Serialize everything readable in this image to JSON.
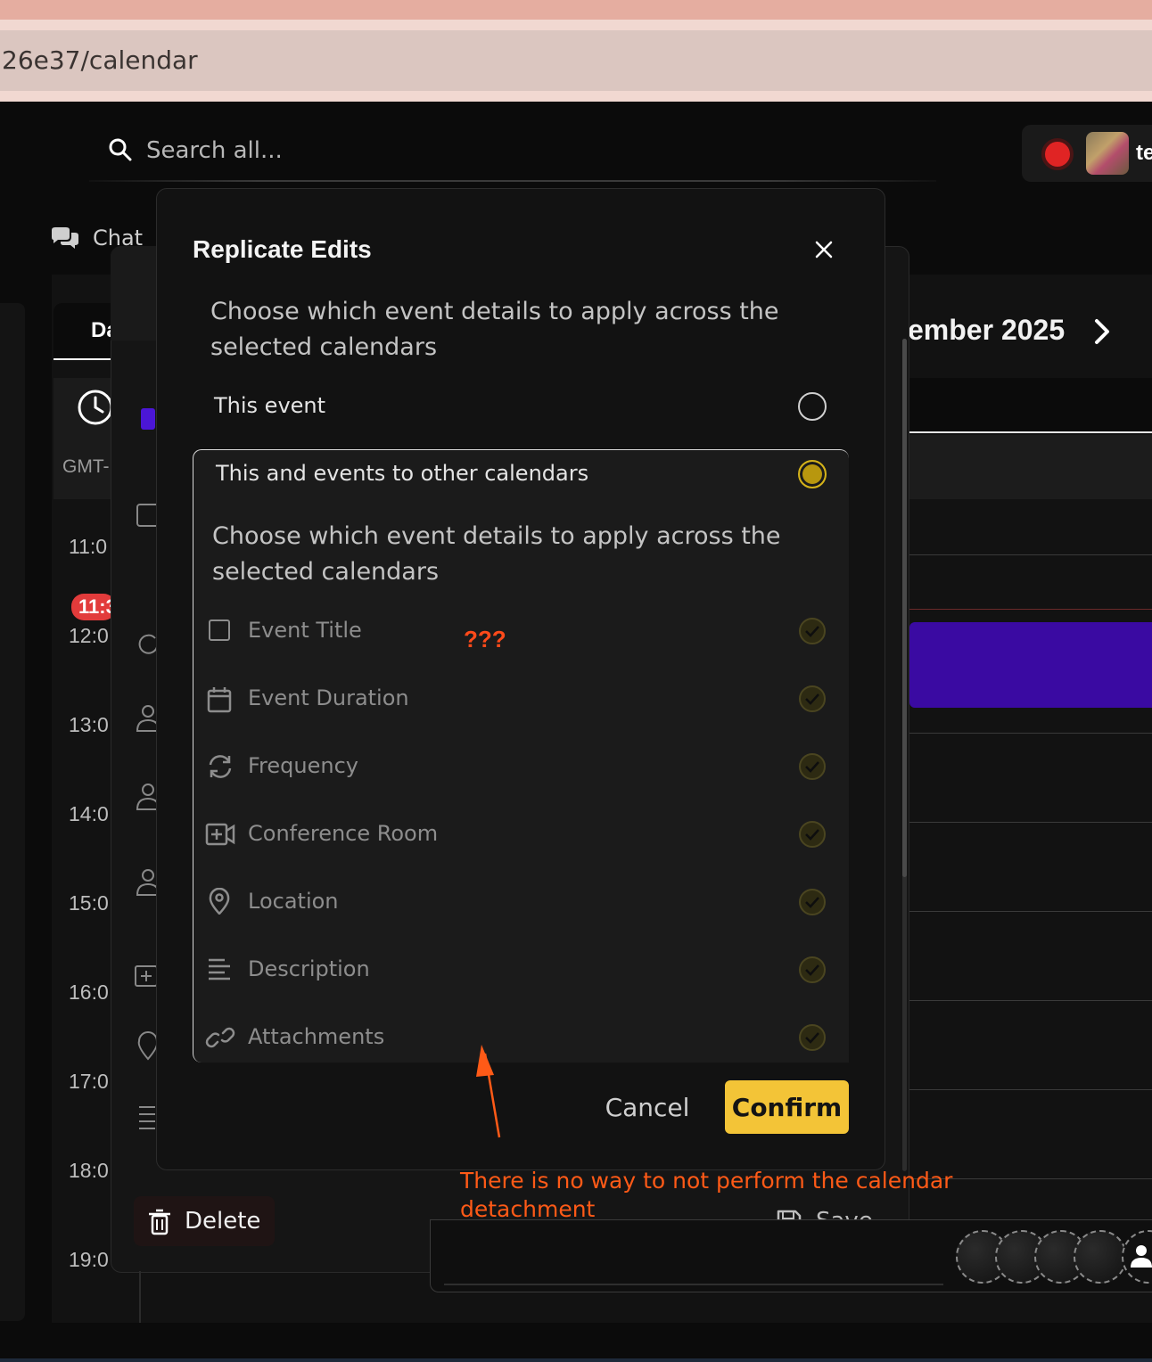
{
  "browser": {
    "url_fragment": "26e37/calendar"
  },
  "header": {
    "search_placeholder": "Search all...",
    "user_name_partial": "te",
    "chat_label": "Chat"
  },
  "calendar": {
    "view_tab_partial": "Da",
    "timezone_partial": "GMT-",
    "month_partial": "ember 2025",
    "now_badge_partial": "11:3",
    "time_labels": [
      "11:0",
      "12:0",
      "13:0",
      "14:0",
      "15:0",
      "16:0",
      "17:0",
      "18:0",
      "19:0"
    ],
    "event_color": "#3a0aa2"
  },
  "editor": {
    "delete_label": "Delete",
    "save_label": "Save"
  },
  "modal": {
    "title": "Replicate Edits",
    "description": "Choose which event details to apply across the selected calendars",
    "option_this_event": "This event",
    "option_other_calendars": "This and events to other calendars",
    "selected_option": "This and events to other calendars",
    "group_description": "Choose which event details to apply across the selected calendars",
    "items": [
      {
        "label": "Event Title",
        "icon": "checkbox-icon"
      },
      {
        "label": "Event Duration",
        "icon": "calendar-icon"
      },
      {
        "label": "Frequency",
        "icon": "repeat-icon"
      },
      {
        "label": "Conference Room",
        "icon": "video-add-icon"
      },
      {
        "label": "Location",
        "icon": "location-pin-icon"
      },
      {
        "label": "Description",
        "icon": "text-lines-icon"
      },
      {
        "label": "Attachments",
        "icon": "link-icon"
      }
    ],
    "cancel_label": "Cancel",
    "confirm_label": "Confirm",
    "accent_color": "#f3c437"
  },
  "annotations": {
    "question": "???",
    "note": "There is no way to not perform the calendar detachment",
    "color": "#ff5a17"
  }
}
